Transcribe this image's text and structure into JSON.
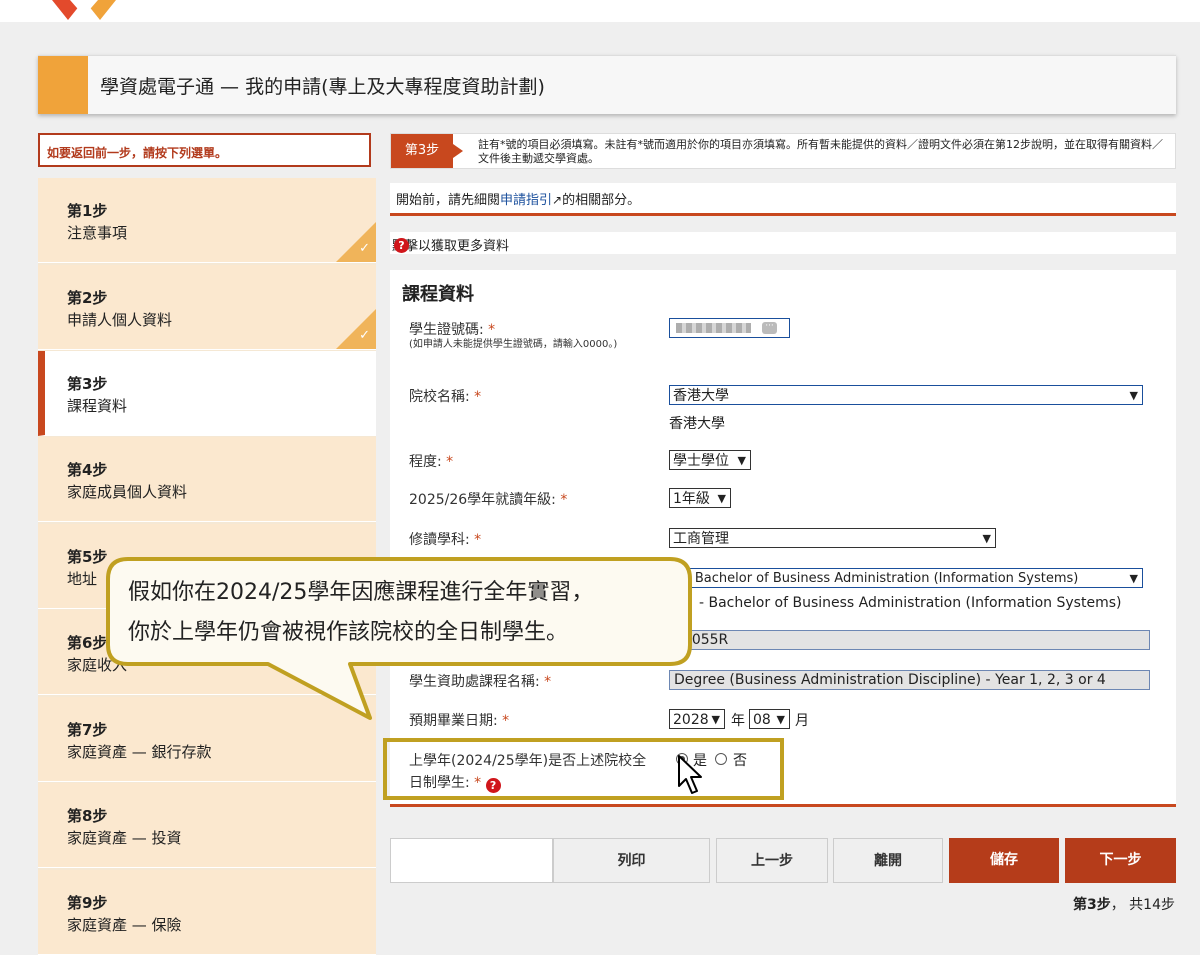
{
  "header": {
    "title": "學資處電子通 — 我的申請(專上及大專程度資助計劃)"
  },
  "back_hint": "如要返回前一步，請按下列選單。",
  "steps": [
    {
      "num": "第1步",
      "name": "注意事項",
      "done": true
    },
    {
      "num": "第2步",
      "name": "申請人個人資料",
      "done": true
    },
    {
      "num": "第3步",
      "name": "課程資料",
      "active": true
    },
    {
      "num": "第4步",
      "name": "家庭成員個人資料"
    },
    {
      "num": "第5步",
      "name": "地址"
    },
    {
      "num": "第6步",
      "name": "家庭收入"
    },
    {
      "num": "第7步",
      "name": "家庭資產 — 銀行存款"
    },
    {
      "num": "第8步",
      "name": "家庭資產 — 投資"
    },
    {
      "num": "第9步",
      "name": "家庭資產 — 保險"
    }
  ],
  "stepbar": {
    "tag": "第3步",
    "note": "註有*號的項目必須填寫。未註有*號而適用於你的項目亦須填寫。所有暫未能提供的資料／證明文件必須在第12步說明，並在取得有關資料／文件後主動遞交學資處。"
  },
  "guide": {
    "prefix": "開始前，請先細閱",
    "link": "申請指引",
    "suffix": "的相關部分。"
  },
  "more_info": {
    "prefix": "點擊",
    "suffix": "以獲取更多資料"
  },
  "form": {
    "section_title": "課程資料",
    "student_id_label": "學生證號碼:",
    "student_id_note": "(如申請人未能提供學生證號碼，請輸入0000。)",
    "institution_label": "院校名稱:",
    "institution_value": "香港大學",
    "institution_text": "香港大學",
    "level_label": "程度:",
    "level_value": "學士學位",
    "year_label": "2025/26學年就讀年級:",
    "year_value": "1年級",
    "discipline_label": "修讀學科:",
    "discipline_value": "工商管理",
    "programme_value": "B - Bachelor of Business Administration (Information Systems)",
    "programme_text": "- Bachelor of Business Administration (Information Systems)",
    "code_value": "01055R",
    "sfo_label": "學生資助處課程名稱:",
    "sfo_value": "Degree (Business Administration Discipline) - Year 1, 2, 3 or 4",
    "grad_label": "預期畢業日期:",
    "grad_year": "2028",
    "grad_year_unit": "年",
    "grad_month": "08",
    "grad_month_unit": "月",
    "fulltime_label_1": "上學年(2024/25學年)是否上述院校全",
    "fulltime_label_2": "日制學生:",
    "yes": "是",
    "no": "否"
  },
  "buttons": {
    "print": "列印",
    "prev": "上一步",
    "leave": "離開",
    "save": "儲存",
    "next": "下一步"
  },
  "pager": {
    "current": "第3步",
    "total": "共14步"
  },
  "bubble": {
    "line1": "假如你在2024/25學年因應課程進行全年實習，",
    "line2": "你於上學年仍會被視作該院校的全日制學生。"
  },
  "colors": {
    "accent": "#c8481e",
    "orange": "#f0a33a",
    "callout_border": "#c0a021"
  }
}
